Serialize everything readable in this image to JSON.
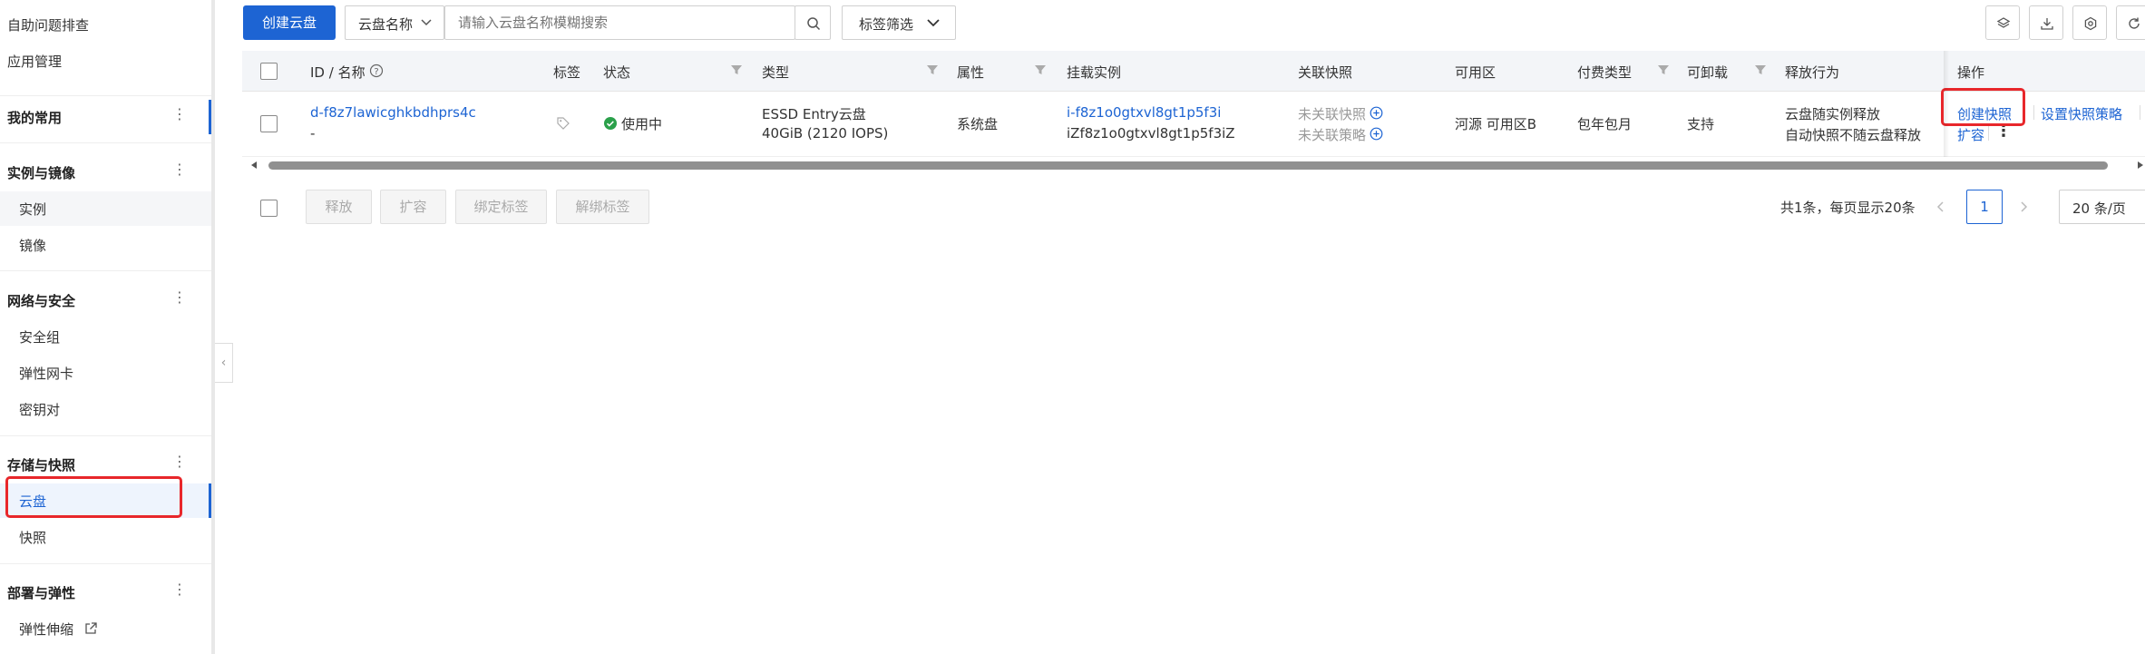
{
  "sidebar": {
    "top_items": [
      "自助问题排查",
      "应用管理"
    ],
    "groups": [
      {
        "title": "我的常用",
        "items": []
      },
      {
        "title": "实例与镜像",
        "items": [
          "实例",
          "镜像"
        ]
      },
      {
        "title": "网络与安全",
        "items": [
          "安全组",
          "弹性网卡",
          "密钥对"
        ]
      },
      {
        "title": "存储与快照",
        "items": [
          "云盘",
          "快照"
        ]
      },
      {
        "title": "部署与弹性",
        "items": [
          "弹性伸缩"
        ]
      }
    ],
    "active_item": "云盘"
  },
  "toolbar": {
    "create_button": "创建云盘",
    "search_field_select": "云盘名称",
    "search_placeholder": "请输入云盘名称模糊搜索",
    "tag_filter": "标签筛选"
  },
  "table": {
    "columns": [
      "ID / 名称",
      "标签",
      "状态",
      "类型",
      "属性",
      "挂载实例",
      "关联快照",
      "可用区",
      "付费类型",
      "可卸载",
      "释放行为",
      "操作"
    ],
    "rows": [
      {
        "id": "d-f8z7lawicghkbdhprs4c",
        "name": "-",
        "status": "使用中",
        "type_line1": "ESSD Entry云盘",
        "type_line2": "40GiB (2120 IOPS)",
        "attribute": "系统盘",
        "instance_id": "i-f8z1o0gtxvl8gt1p5f3i",
        "instance_name": "iZf8z1o0gtxvl8gt1p5f3iZ",
        "snapshot_line1": "未关联快照",
        "snapshot_line2": "未关联策略",
        "zone": "河源 可用区B",
        "billing": "包年包月",
        "detachable": "支持",
        "release_line1": "云盘随实例释放",
        "release_line2": "自动快照不随云盘释放",
        "actions": [
          "创建快照",
          "设置快照策略",
          "扩容"
        ]
      }
    ]
  },
  "bulk_actions": [
    "释放",
    "扩容",
    "绑定标签",
    "解绑标签"
  ],
  "pagination": {
    "summary": "共1条，每页显示20条",
    "current_page": "1",
    "page_size": "20 条/页"
  },
  "colors": {
    "primary": "#1d64d3",
    "highlight": "#e8272b",
    "status_ok": "#2aa04a"
  }
}
